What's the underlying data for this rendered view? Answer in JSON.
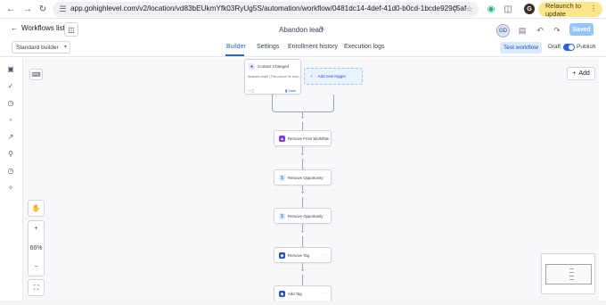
{
  "browser": {
    "url": "app.gohighlevel.com/v2/location/vd83bEUkmYfk03RyUg5S/automation/workflow/0481dc14-4def-41d0-b0cd-1bcde929c5af",
    "profile_initial": "G",
    "relaunch_label": "Relaunch to update"
  },
  "header": {
    "back_label": "Workflows list",
    "workflow_title": "Abandon lead",
    "user_initials": "GD",
    "saved_label": "Saved"
  },
  "tabs": {
    "builder_select": "Standard builder",
    "items": [
      "Builder",
      "Settings",
      "Enrollment history",
      "Execution logs"
    ],
    "active": "Builder",
    "test_workflow_label": "Test workflow",
    "draft_label": "Draft",
    "publish_label": "Publish",
    "publish_on": true
  },
  "canvas": {
    "add_label": "Add",
    "zoom_in": "+",
    "zoom_level": "66%",
    "zoom_out": "−",
    "trigger": {
      "title": "Contact Changed",
      "description": "Abandon lead! (This cannot be rese...",
      "stats_label": "Stats"
    },
    "add_trigger_label": "Add new trigger",
    "actions": [
      {
        "label": "Remove From Workflow",
        "icon": "workflow-icon",
        "color": "#7c3aed"
      },
      {
        "label": "Remove Opportunity",
        "icon": "dollar-icon",
        "color": "#2563eb"
      },
      {
        "label": "Remove Opportunity",
        "icon": "dollar-icon",
        "color": "#2563eb"
      },
      {
        "label": "Remove Tag",
        "icon": "tag-icon",
        "color": "#2563eb"
      },
      {
        "label": "Add Tag",
        "icon": "tag-icon",
        "color": "#2563eb"
      }
    ]
  }
}
